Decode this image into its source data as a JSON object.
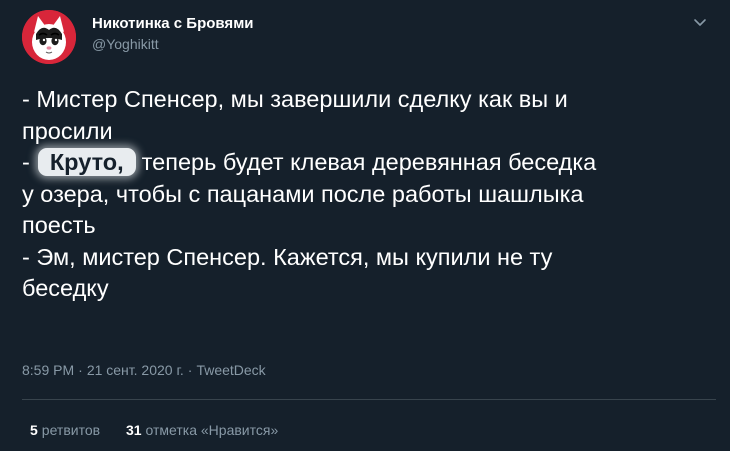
{
  "author": {
    "display_name": "Никотинка с Бровями",
    "handle": "@Yoghikitt"
  },
  "icons": {
    "avatar": "cat-avatar",
    "menu": "chevron-down-icon"
  },
  "tweet": {
    "lines": [
      "- Мистер Спенсер, мы завершили сделку как вы и",
      "просили",
      "-",
      "Круто,",
      "теперь будет клевая деревянная беседка",
      "у озера, чтобы с пацанами после работы шашлыка",
      "поесть",
      "- Эм, мистер Спенсер. Кажется, мы купили не ту",
      "беседку"
    ]
  },
  "meta": {
    "time": "8:59 PM",
    "date": "21 сент. 2020 г.",
    "source": "TweetDeck"
  },
  "stats": {
    "retweets_count": "5",
    "retweets_label": "ретвитов",
    "likes_count": "31",
    "likes_label": "отметка «Нравится»"
  },
  "colors": {
    "background": "#15202b",
    "text": "#ffffff",
    "secondary_text": "#8899a6",
    "divider": "#38444d",
    "avatar_bg": "#d8263a"
  }
}
